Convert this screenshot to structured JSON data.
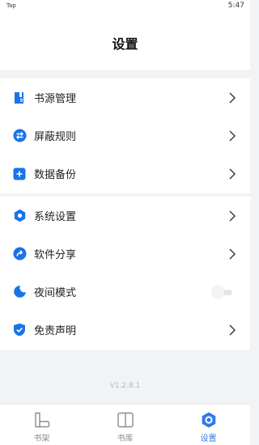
{
  "status_bar": {
    "carrier": "Tap",
    "time": "5:47"
  },
  "header": {
    "title": "设置"
  },
  "group1": [
    {
      "label": "书源管理",
      "icon": "book-source-icon"
    },
    {
      "label": "屏蔽规则",
      "icon": "swap-icon"
    },
    {
      "label": "数据备份",
      "icon": "plus-square-icon"
    }
  ],
  "group2": [
    {
      "label": "系统设置",
      "icon": "hexagon-gear-icon"
    },
    {
      "label": "软件分享",
      "icon": "share-arrow-icon"
    },
    {
      "label": "夜间模式",
      "icon": "moon-icon"
    },
    {
      "label": "免责声明",
      "icon": "shield-check-icon"
    }
  ],
  "night_mode": {
    "enabled": false
  },
  "version": "V1.2.8.1",
  "tabs": [
    {
      "label": "书架",
      "icon": "bookshelf-icon",
      "active": false
    },
    {
      "label": "书库",
      "icon": "book-open-icon",
      "active": false
    },
    {
      "label": "设置",
      "icon": "settings-icon",
      "active": true
    }
  ],
  "colors": {
    "accent": "#2f7be6",
    "icon_blue": "#1a73e8"
  }
}
